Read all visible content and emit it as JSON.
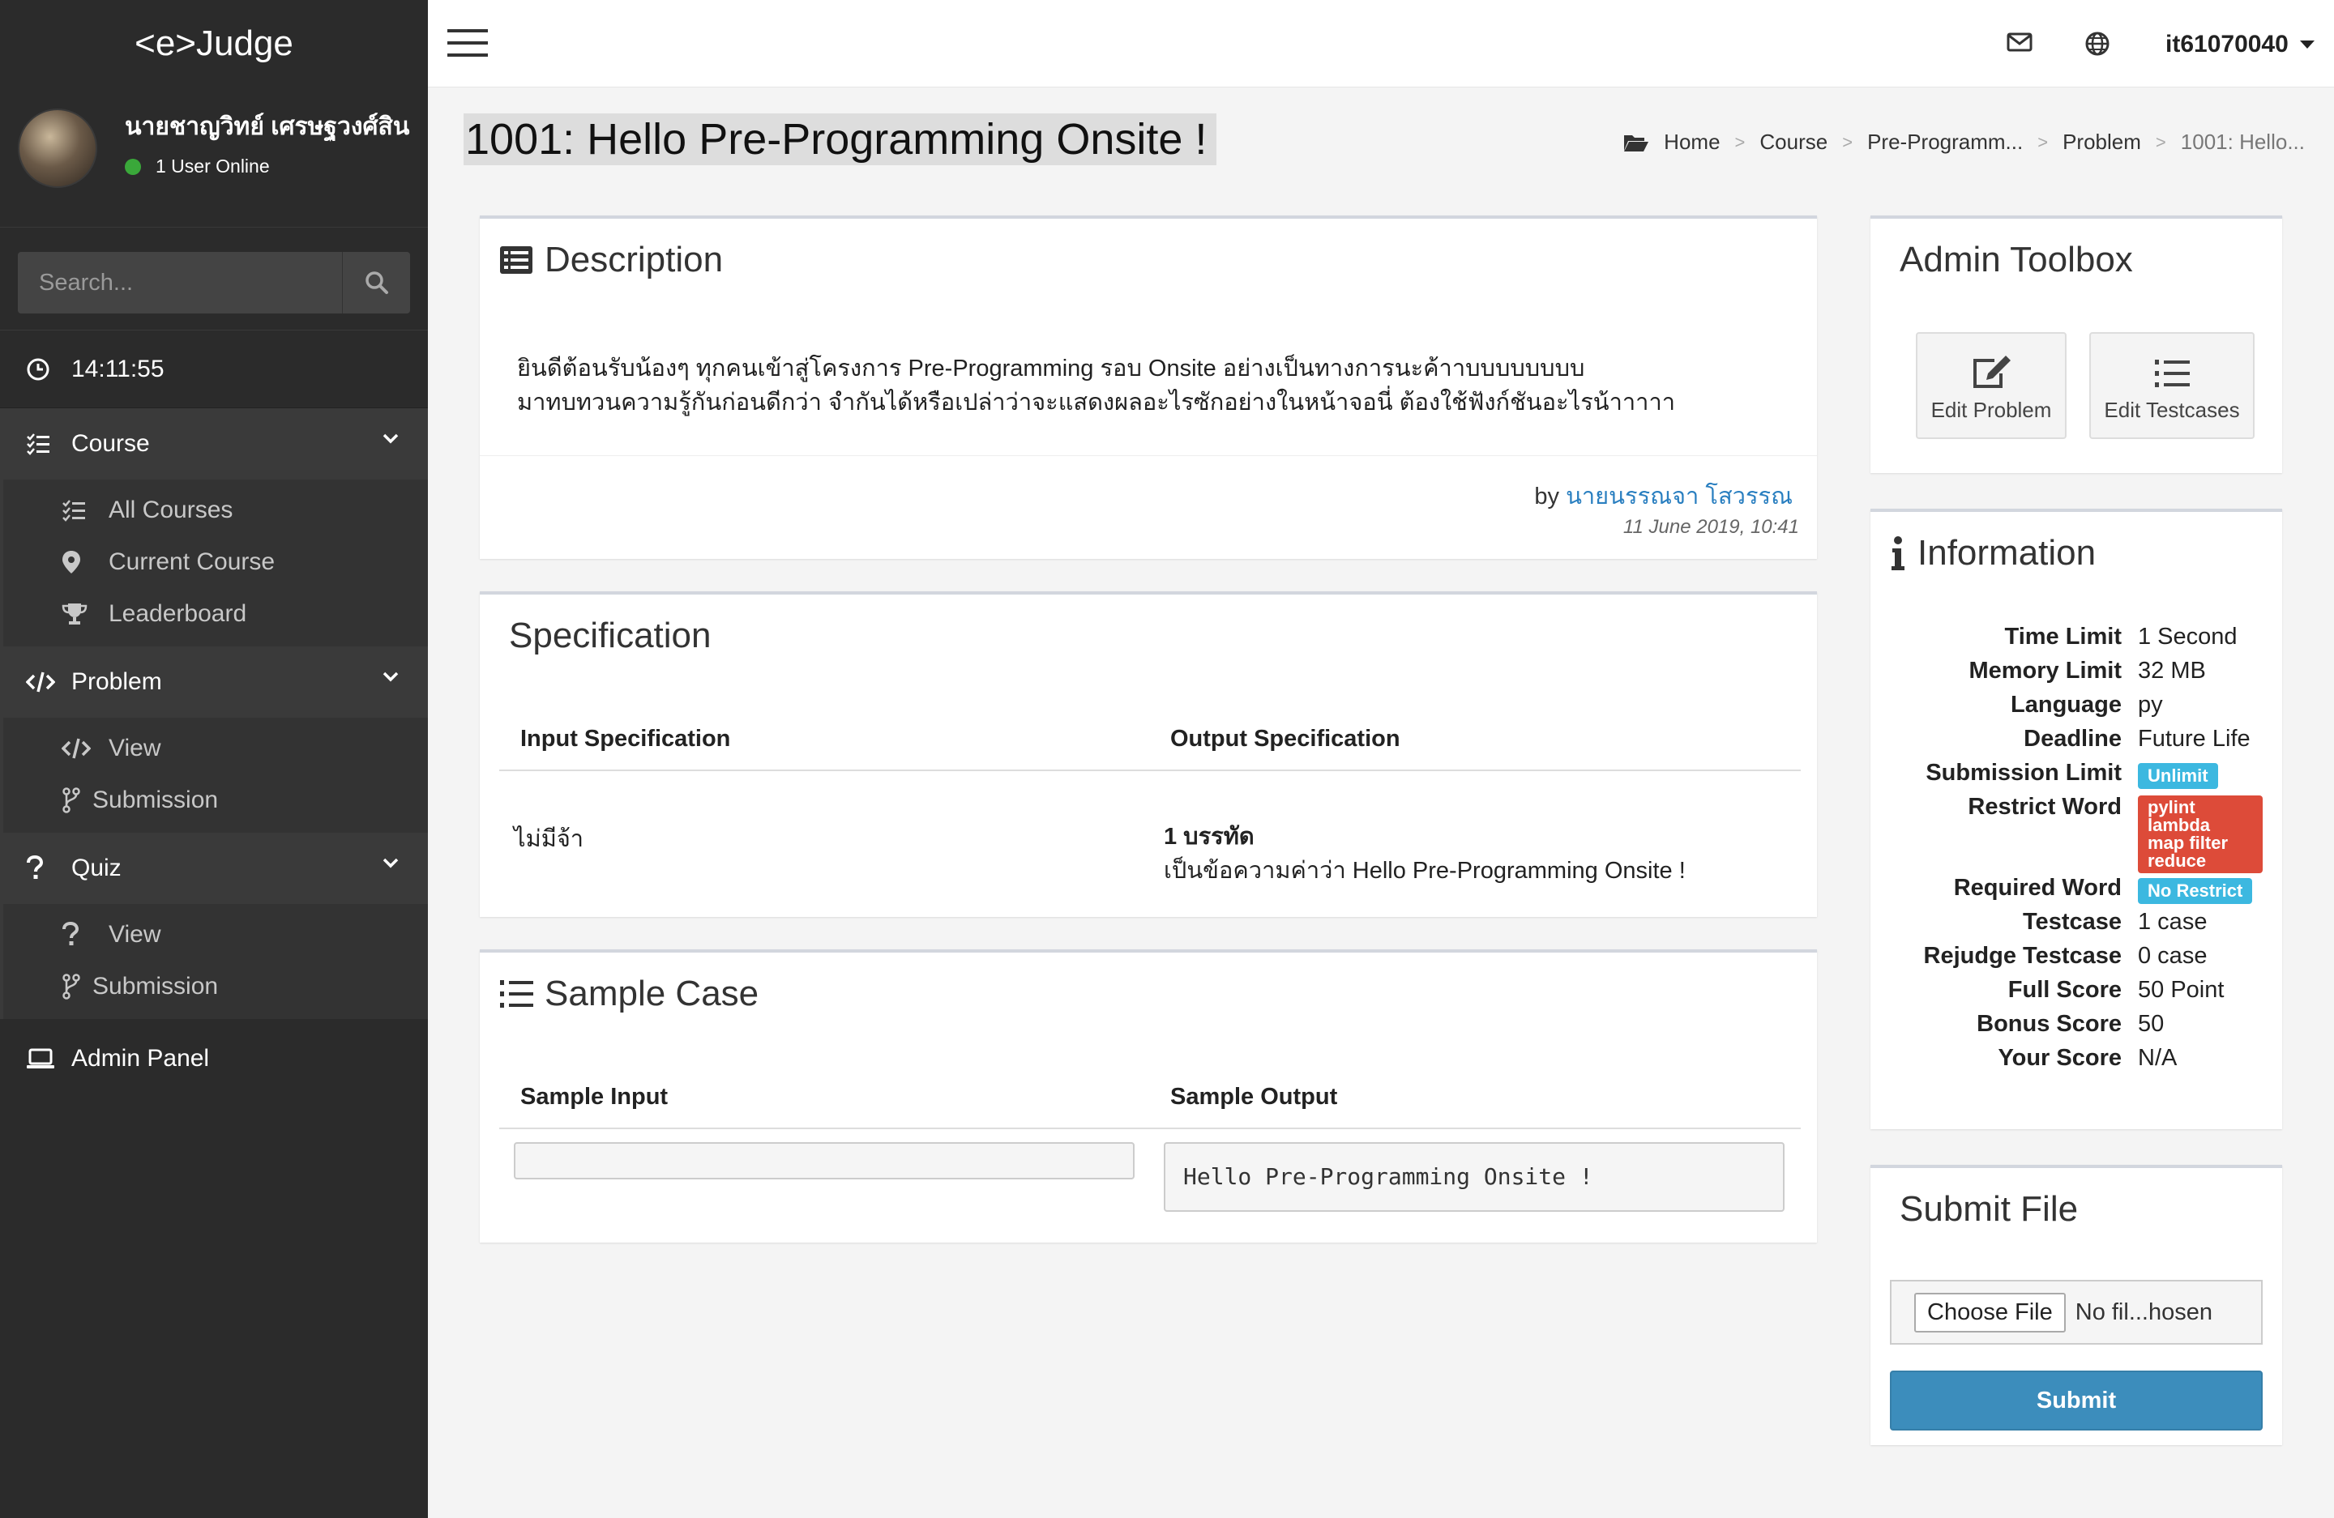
{
  "app": {
    "brand": "<e>Judge"
  },
  "user": {
    "name": "นายชาญวิทย์ เศรษฐวงศ์สิน",
    "status": "1 User Online",
    "username": "it61070040"
  },
  "search": {
    "placeholder": "Search..."
  },
  "clock": "14:11:55",
  "nav": {
    "course": {
      "label": "Course",
      "items": [
        "All Courses",
        "Current Course",
        "Leaderboard"
      ]
    },
    "problem": {
      "label": "Problem",
      "items": [
        "View",
        "Submission"
      ]
    },
    "quiz": {
      "label": "Quiz",
      "items": [
        "View",
        "Submission"
      ]
    },
    "admin": "Admin Panel"
  },
  "page": {
    "title": "1001: Hello Pre-Programming Onsite !"
  },
  "breadcrumb": [
    "Home",
    "Course",
    "Pre-Programm...",
    "Problem",
    "1001: Hello..."
  ],
  "description": {
    "title": "Description",
    "line1": "ยินดีต้อนรับน้องๆ ทุกคนเข้าสู่โครงการ Pre-Programming รอบ Onsite อย่างเป็นทางการนะค้าาบบบบบบบบ",
    "line2": "มาทบทวนความรู้กันก่อนดีกว่า จำกันได้หรือเปล่าว่าจะแสดงผลอะไรซักอย่างในหน้าจอนี่ ต้องใช้ฟังก์ชันอะไรน้าาาาา",
    "by": "by",
    "author": "นายนรรณจา โสวรรณ",
    "date": "11 June 2019, 10:41"
  },
  "specification": {
    "title": "Specification",
    "input_header": "Input Specification",
    "output_header": "Output Specification",
    "input": "ไม่มีจ้า",
    "output_bold": "1 บรรทัด",
    "output_text": "เป็นข้อความค่าว่า Hello Pre-Programming Onsite !"
  },
  "sample": {
    "title": "Sample Case",
    "input_header": "Sample Input",
    "output_header": "Sample Output",
    "input": "",
    "output": "Hello Pre-Programming Onsite !"
  },
  "toolbox": {
    "title": "Admin Toolbox",
    "edit_problem": "Edit Problem",
    "edit_testcases": "Edit Testcases"
  },
  "info": {
    "title": "Information",
    "rows": {
      "time_limit": {
        "k": "Time Limit",
        "v": "1 Second"
      },
      "memory_limit": {
        "k": "Memory Limit",
        "v": "32 MB"
      },
      "language": {
        "k": "Language",
        "v": "py"
      },
      "deadline": {
        "k": "Deadline",
        "v": "Future Life"
      },
      "submission_limit": {
        "k": "Submission Limit",
        "v": "Unlimit"
      },
      "restrict_word": {
        "k": "Restrict Word",
        "v": [
          "pylint",
          "lambda",
          "map filter",
          "reduce"
        ]
      },
      "required_word": {
        "k": "Required Word",
        "v": "No Restrict"
      },
      "testcase": {
        "k": "Testcase",
        "v": "1 case"
      },
      "rejudge_testcase": {
        "k": "Rejudge Testcase",
        "v": "0 case"
      },
      "full_score": {
        "k": "Full Score",
        "v": "50 Point"
      },
      "bonus_score": {
        "k": "Bonus Score",
        "v": "50"
      },
      "your_score": {
        "k": "Your Score",
        "v": "N/A"
      }
    }
  },
  "submit": {
    "title": "Submit File",
    "choose": "Choose File",
    "no_file": "No fil...hosen",
    "button": "Submit"
  },
  "colors": {
    "sidebar": "#2b2b2b",
    "primary": "#3c8dbc",
    "badge_blue": "#3cb8e0",
    "badge_red": "#dd4b39",
    "link": "#2a7fc0"
  }
}
